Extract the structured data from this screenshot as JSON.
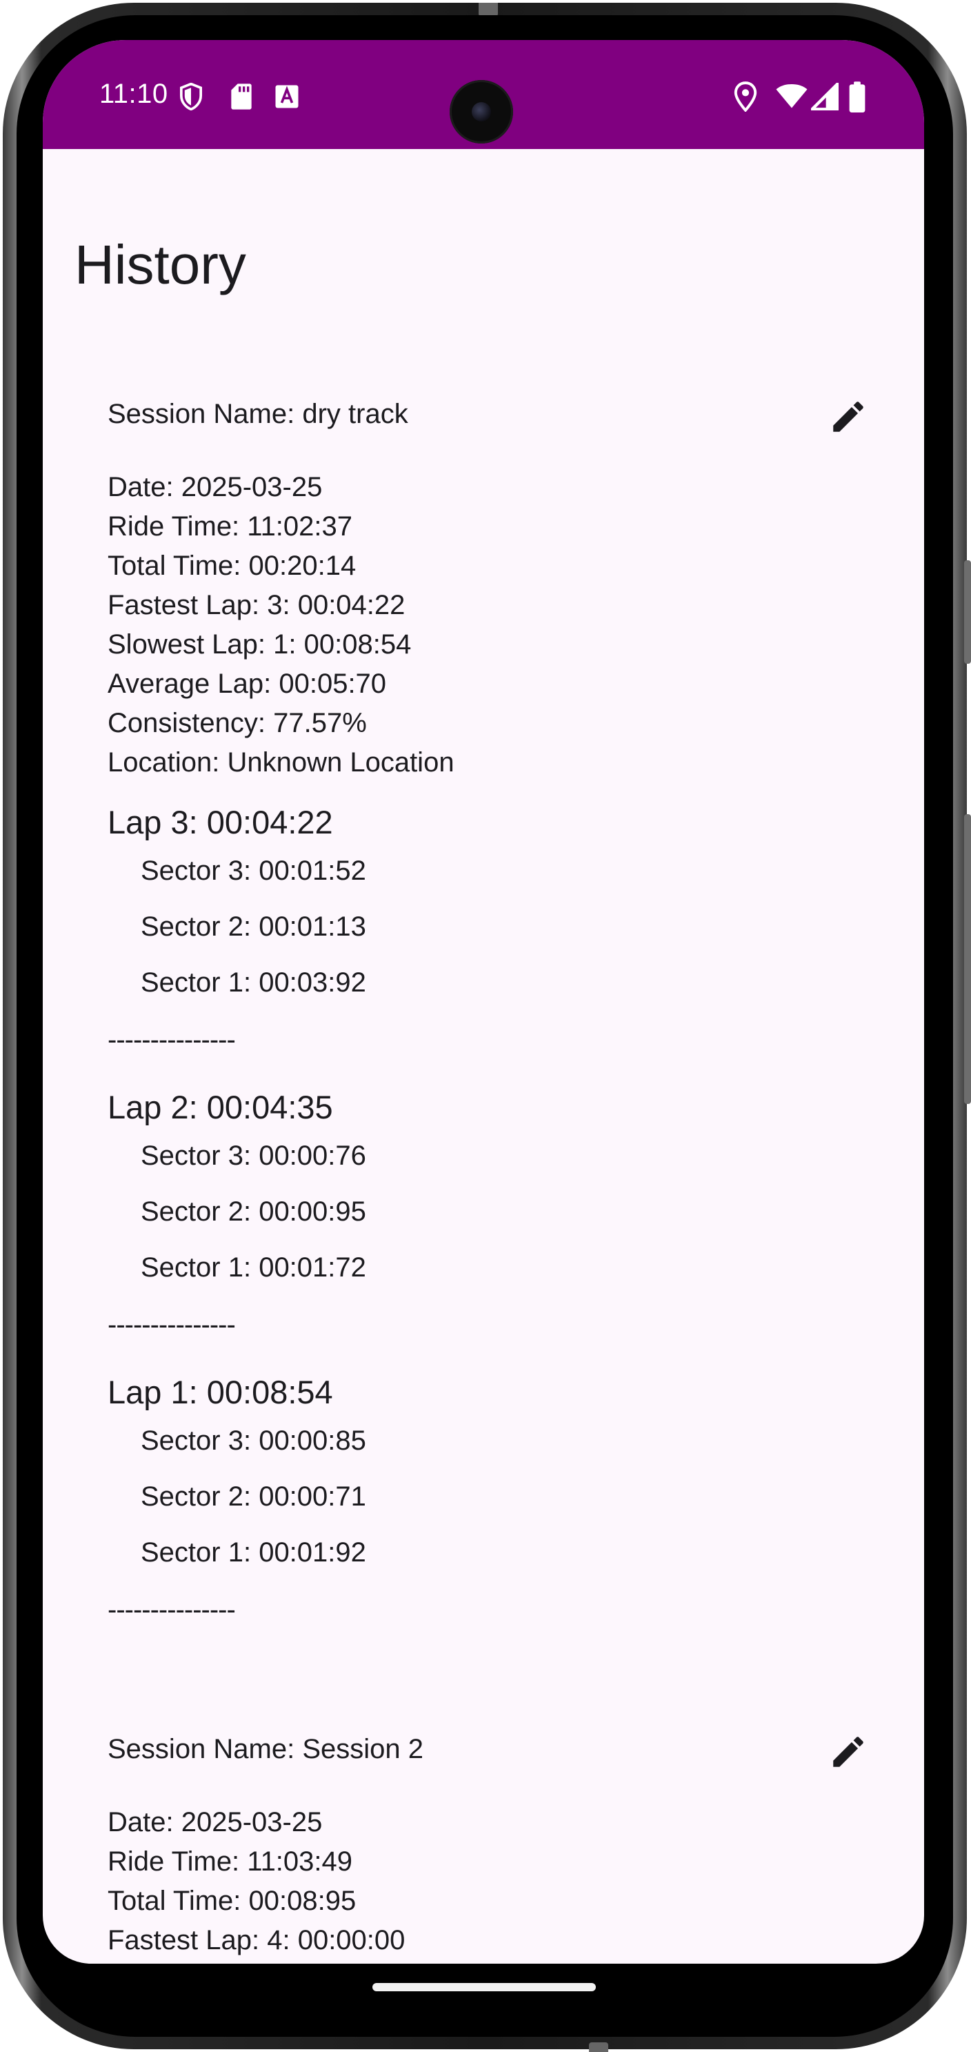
{
  "status_bar": {
    "time": "11:10",
    "left_icons": [
      "shield-icon",
      "sd-card-icon",
      "text-a-icon"
    ],
    "right_icons": [
      "location-icon",
      "wifi-icon",
      "signal-icon",
      "battery-icon"
    ],
    "color": "#800080"
  },
  "page": {
    "title": "History"
  },
  "sessions": [
    {
      "name": "Session Name: dry track",
      "date": "Date: 2025-03-25",
      "ride_time": "Ride Time: 11:02:37",
      "total_time": "Total Time: 00:20:14",
      "fastest_lap": "Fastest Lap: 3: 00:04:22",
      "slowest_lap": "Slowest Lap: 1: 00:08:54",
      "average_lap": "Average Lap: 00:05:70",
      "consistency": "Consistency: 77.57%",
      "location": "Location: Unknown Location",
      "laps": [
        {
          "title": "Lap 3: 00:04:22",
          "sectors": [
            "Sector 3: 00:01:52",
            "Sector 2: 00:01:13",
            "Sector 1: 00:03:92"
          ],
          "separator": "---------------"
        },
        {
          "title": "Lap 2: 00:04:35",
          "sectors": [
            "Sector 3: 00:00:76",
            "Sector 2: 00:00:95",
            "Sector 1: 00:01:72"
          ],
          "separator": "---------------"
        },
        {
          "title": "Lap 1: 00:08:54",
          "sectors": [
            "Sector 3: 00:00:85",
            "Sector 2: 00:00:71",
            "Sector 1: 00:01:92"
          ],
          "separator": "---------------"
        }
      ]
    },
    {
      "name": "Session Name: Session 2",
      "date": "Date: 2025-03-25",
      "ride_time": "Ride Time: 11:03:49",
      "total_time": "Total Time: 00:08:95",
      "fastest_lap": "Fastest Lap: 4: 00:00:00"
    }
  ]
}
